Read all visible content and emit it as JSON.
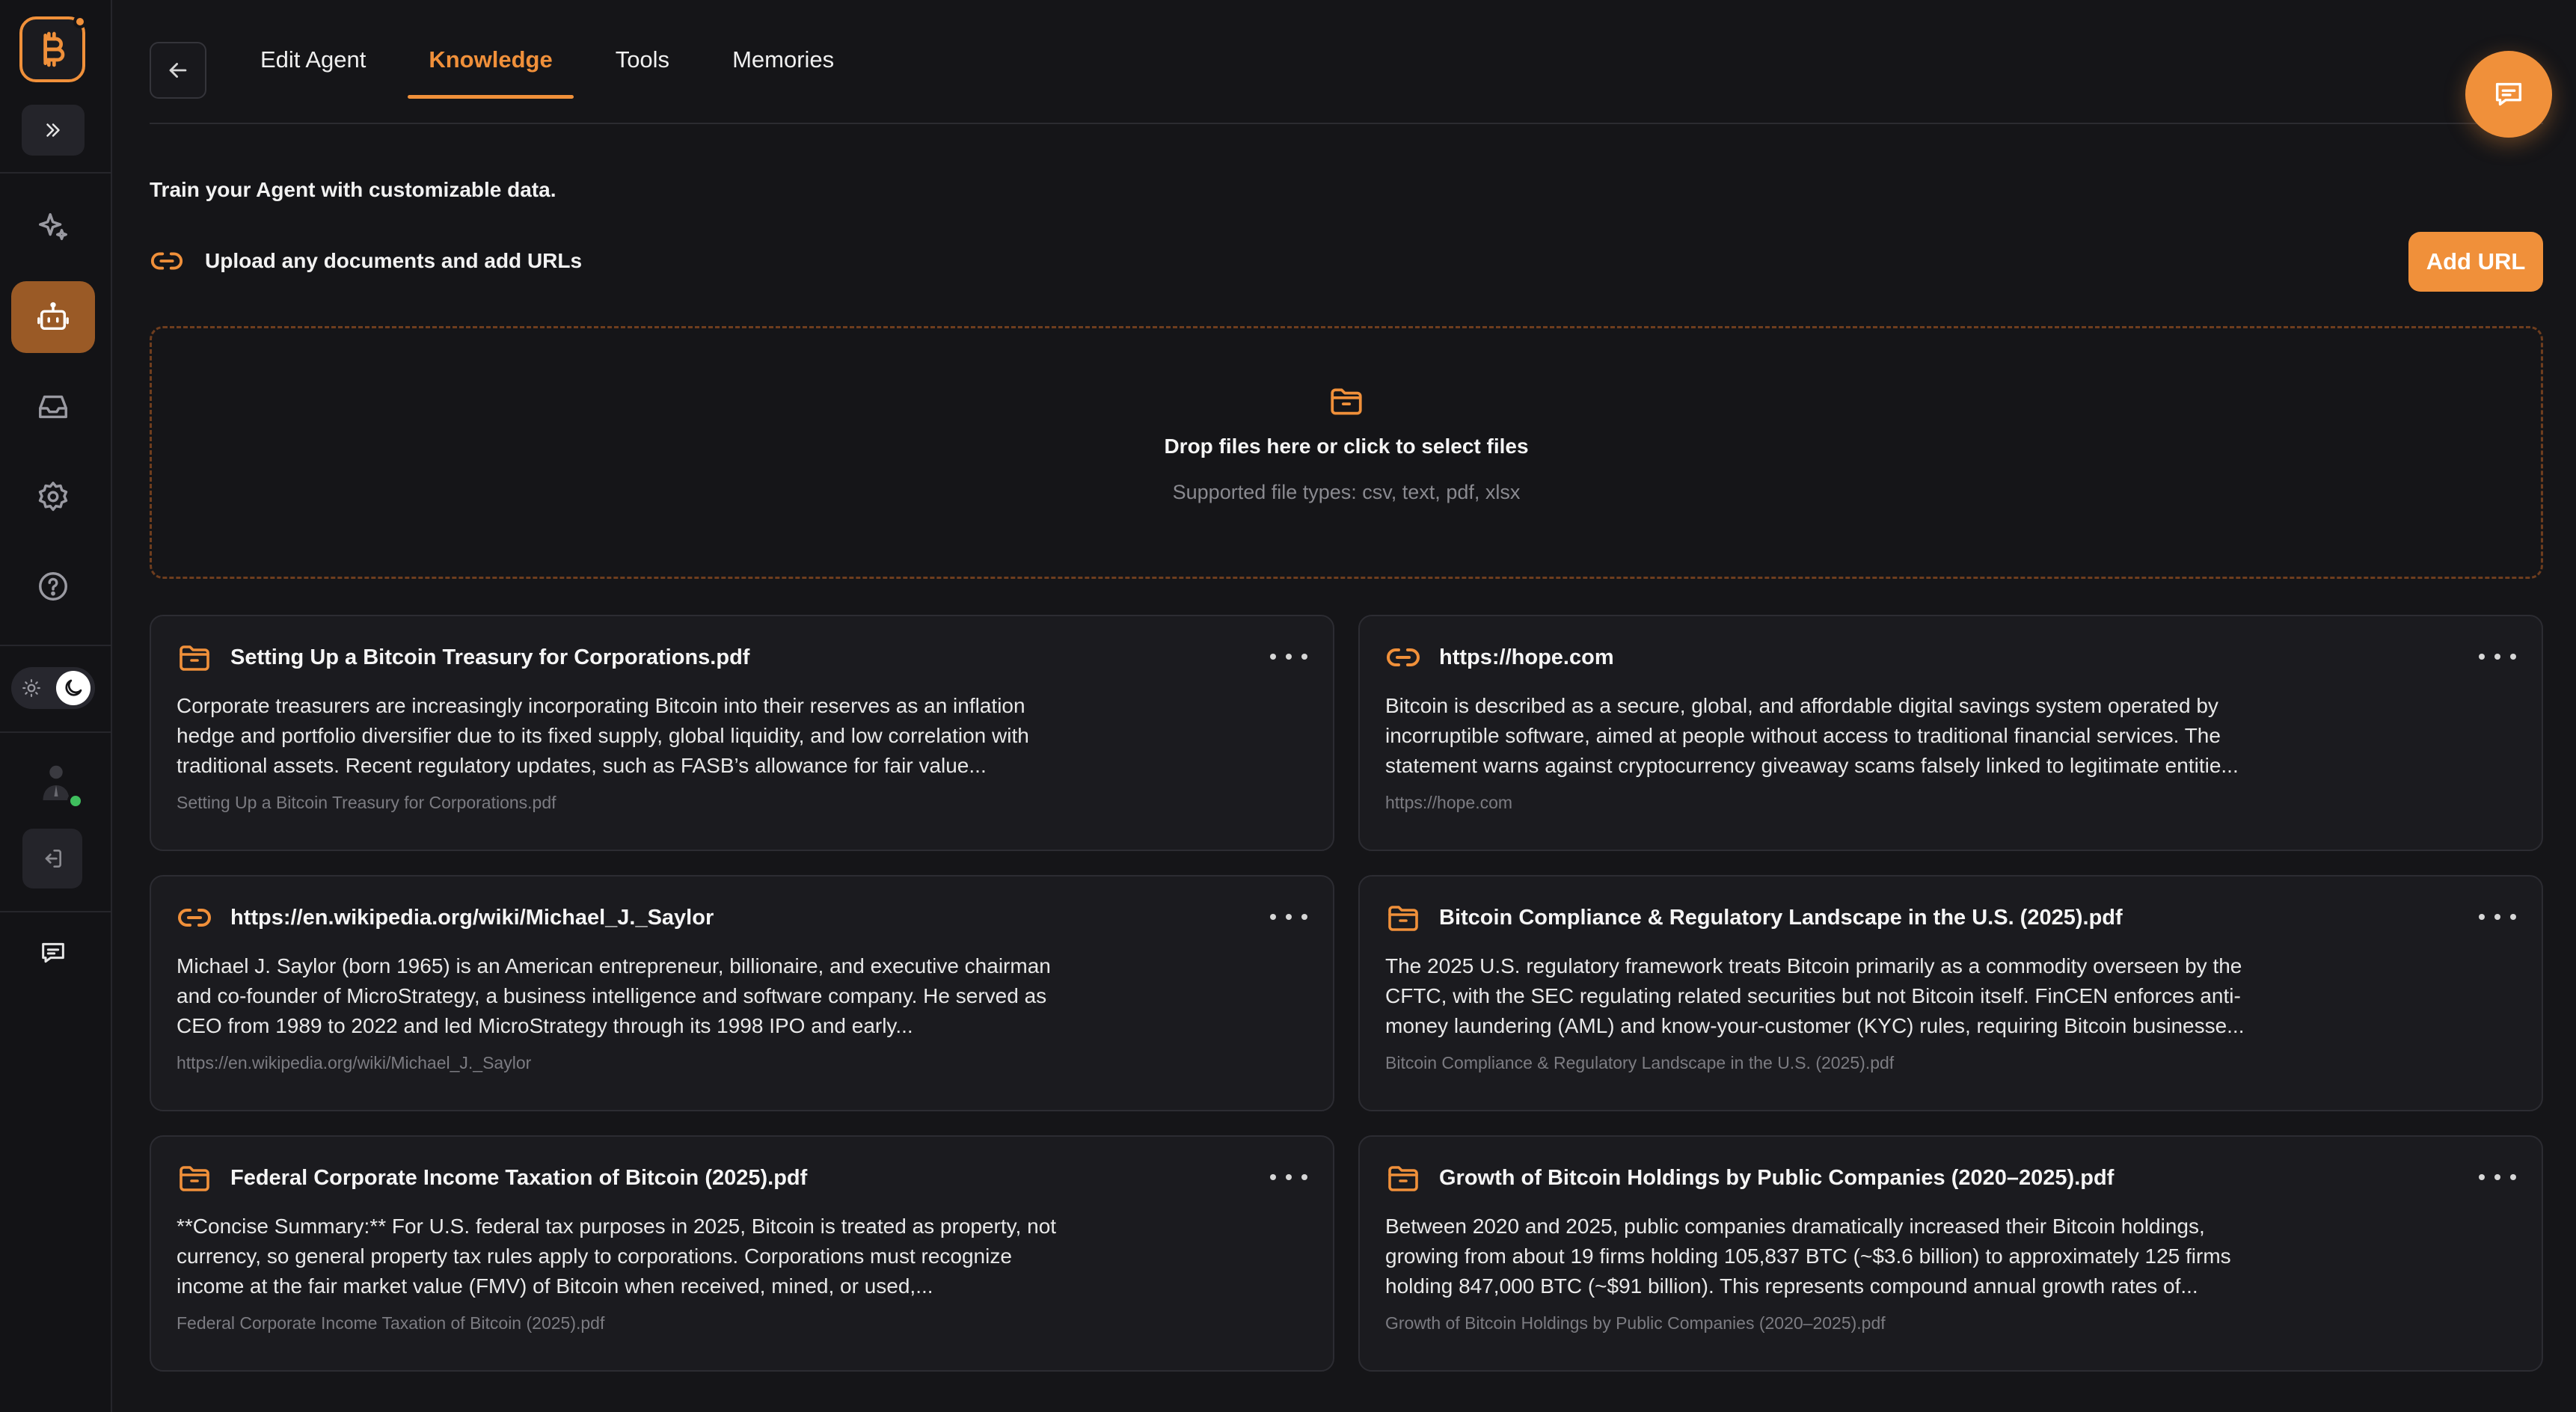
{
  "colors": {
    "accent": "#f0903a",
    "background": "#151518",
    "card": "#1b1b1f",
    "online": "#3fbf5e"
  },
  "sidebar": {
    "logo_icon": "bitcoin-logo-icon",
    "items": [
      {
        "name": "sparkle",
        "icon": "sparkle-icon"
      },
      {
        "name": "agents",
        "icon": "robot-icon",
        "active": true
      },
      {
        "name": "inbox",
        "icon": "inbox-icon"
      },
      {
        "name": "settings",
        "icon": "gear-icon"
      },
      {
        "name": "help",
        "icon": "help-circle-icon"
      }
    ],
    "theme": "dark"
  },
  "nav": {
    "tabs": [
      {
        "label": "Edit Agent",
        "active": false
      },
      {
        "label": "Knowledge",
        "active": true
      },
      {
        "label": "Tools",
        "active": false
      },
      {
        "label": "Memories",
        "active": false
      }
    ]
  },
  "knowledge": {
    "intro": "Train your Agent with customizable data.",
    "upload_label": "Upload any documents and add URLs",
    "add_url_label": "Add URL",
    "dropzone": {
      "title": "Drop files here or click to select files",
      "subtitle": "Supported file types: csv, text, pdf, xlsx"
    },
    "items": [
      {
        "type": "file",
        "title": "Setting Up a Bitcoin Treasury for Corporations.pdf",
        "description": "Corporate treasurers are increasingly incorporating Bitcoin into their reserves as an inflation hedge and portfolio diversifier due to its fixed supply, global liquidity, and low correlation with traditional assets. Recent regulatory updates, such as FASB’s allowance for fair value...",
        "source": "Setting Up a Bitcoin Treasury for Corporations.pdf"
      },
      {
        "type": "link",
        "title": "https://hope.com",
        "description": "Bitcoin is described as a secure, global, and affordable digital savings system operated by incorruptible software, aimed at people without access to traditional financial services. The statement warns against cryptocurrency giveaway scams falsely linked to legitimate entitie...",
        "source": "https://hope.com"
      },
      {
        "type": "link",
        "title": "https://en.wikipedia.org/wiki/Michael_J._Saylor",
        "description": "Michael J. Saylor (born 1965) is an American entrepreneur, billionaire, and executive chairman and co-founder of MicroStrategy, a business intelligence and software company. He served as CEO from 1989 to 2022 and led MicroStrategy through its 1998 IPO and early...",
        "source": "https://en.wikipedia.org/wiki/Michael_J._Saylor"
      },
      {
        "type": "file",
        "title": "Bitcoin Compliance & Regulatory Landscape in the U.S. (2025).pdf",
        "description": "The 2025 U.S. regulatory framework treats Bitcoin primarily as a commodity overseen by the CFTC, with the SEC regulating related securities but not Bitcoin itself. FinCEN enforces anti-money laundering (AML) and know-your-customer (KYC) rules, requiring Bitcoin businesse...",
        "source": "Bitcoin Compliance & Regulatory Landscape in the U.S. (2025).pdf"
      },
      {
        "type": "file",
        "title": "Federal Corporate Income Taxation of Bitcoin (2025).pdf",
        "description": "**Concise Summary:** For U.S. federal tax purposes in 2025, Bitcoin is treated as property, not currency, so general property tax rules apply to corporations. Corporations must recognize income at the fair market value (FMV) of Bitcoin when received, mined, or used,...",
        "source": "Federal Corporate Income Taxation of Bitcoin (2025).pdf"
      },
      {
        "type": "file",
        "title": "Growth of Bitcoin Holdings by Public Companies (2020–2025).pdf",
        "description": "Between 2020 and 2025, public companies dramatically increased their Bitcoin holdings, growing from about 19 firms holding 105,837 BTC (~$3.6 billion) to approximately 125 firms holding 847,000 BTC (~$91 billion). This represents compound annual growth rates of...",
        "source": "Growth of Bitcoin Holdings by Public Companies (2020–2025).pdf"
      }
    ]
  }
}
